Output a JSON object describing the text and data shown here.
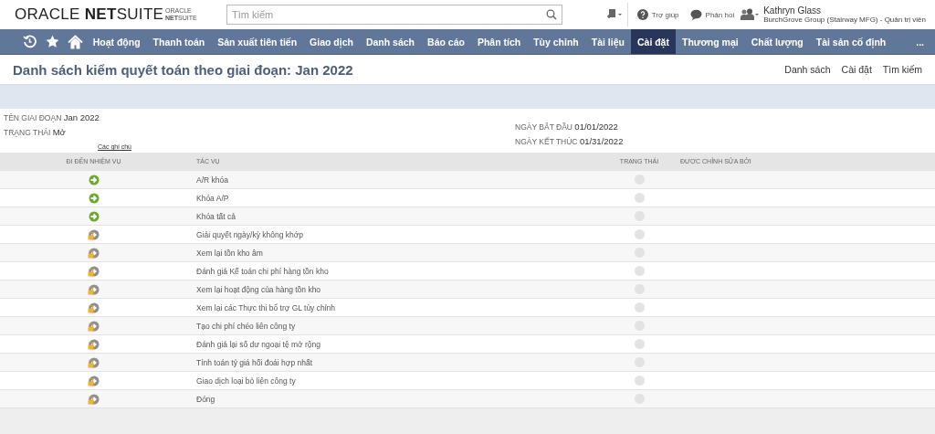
{
  "header": {
    "logo": {
      "brand": "ORACLE",
      "product_bold": "NET",
      "product": "SUITE"
    },
    "account_logo": {
      "brand": "ORACLE",
      "product_bold": "NET",
      "product": "SUITE"
    },
    "search": {
      "placeholder": "Tìm kiếm"
    },
    "help": "Trợ giúp",
    "feedback": "Phản hồi",
    "user": {
      "name": "Kathryn Glass",
      "role": "BurchGrove Group (Stairway MFG) - Quản trị viên"
    }
  },
  "nav": [
    {
      "label": "Hoạt động",
      "selected": false
    },
    {
      "label": "Thanh toán",
      "selected": false
    },
    {
      "label": "Sản xuất tiên tiến",
      "selected": false
    },
    {
      "label": "Giao dịch",
      "selected": false
    },
    {
      "label": "Danh sách",
      "selected": false
    },
    {
      "label": "Báo cáo",
      "selected": false
    },
    {
      "label": "Phân tích",
      "selected": false
    },
    {
      "label": "Tùy chỉnh",
      "selected": false
    },
    {
      "label": "Tài liệu",
      "selected": false
    },
    {
      "label": "Cài đặt",
      "selected": true
    },
    {
      "label": "Thương mại",
      "selected": false
    },
    {
      "label": "Chất lượng",
      "selected": false
    },
    {
      "label": "Tài sản cố định",
      "selected": false
    },
    {
      "label": "...",
      "selected": false
    }
  ],
  "page": {
    "title": "Danh sách kiểm quyết toán theo giai đoạn: Jan 2022",
    "links": [
      "Danh sách",
      "Cài đặt",
      "Tìm kiếm"
    ]
  },
  "info": {
    "left": [
      {
        "label": "TÊN GIAI ĐOẠN",
        "value": "Jan 2022"
      },
      {
        "label": "TRẠNG THÁI",
        "value": "Mở"
      }
    ],
    "right": [
      {
        "label": "NGÀY BẮT ĐẦU",
        "value": "01/01/2022"
      },
      {
        "label": "NGÀY KẾT THÚC",
        "value": "01/31/2022"
      }
    ],
    "notes_link": "Các ghi chú"
  },
  "table": {
    "columns": [
      "ĐI ĐẾN NHIỆM VỤ",
      "TÁC VỤ",
      "TRẠNG THÁI",
      "ĐƯỢC CHỈNH SỬA BỞI"
    ],
    "rows": [
      {
        "task": "A/R khóa",
        "locked": false
      },
      {
        "task": "Khóa A/P",
        "locked": false
      },
      {
        "task": "Khóa tất cả",
        "locked": false
      },
      {
        "task": "Giải quyết ngày/kỳ không khớp",
        "locked": true
      },
      {
        "task": "Xem lại tồn kho âm",
        "locked": true
      },
      {
        "task": "Đánh giá Kế toán chi phí hàng tồn kho",
        "locked": true
      },
      {
        "task": "Xem lại hoạt động của hàng tồn kho",
        "locked": true
      },
      {
        "task": "Xem lại các Thực thi bổ trợ GL tùy chỉnh",
        "locked": true
      },
      {
        "task": "Tạo chi phí chéo liên công ty",
        "locked": true
      },
      {
        "task": "Đánh giá lại số dư ngoại tệ mở rộng",
        "locked": true
      },
      {
        "task": "Tính toán tỷ giá hối đoái hợp nhất",
        "locked": true
      },
      {
        "task": "Giao dịch loại bỏ liên công ty",
        "locked": true
      },
      {
        "task": "Đóng",
        "locked": true
      }
    ]
  }
}
